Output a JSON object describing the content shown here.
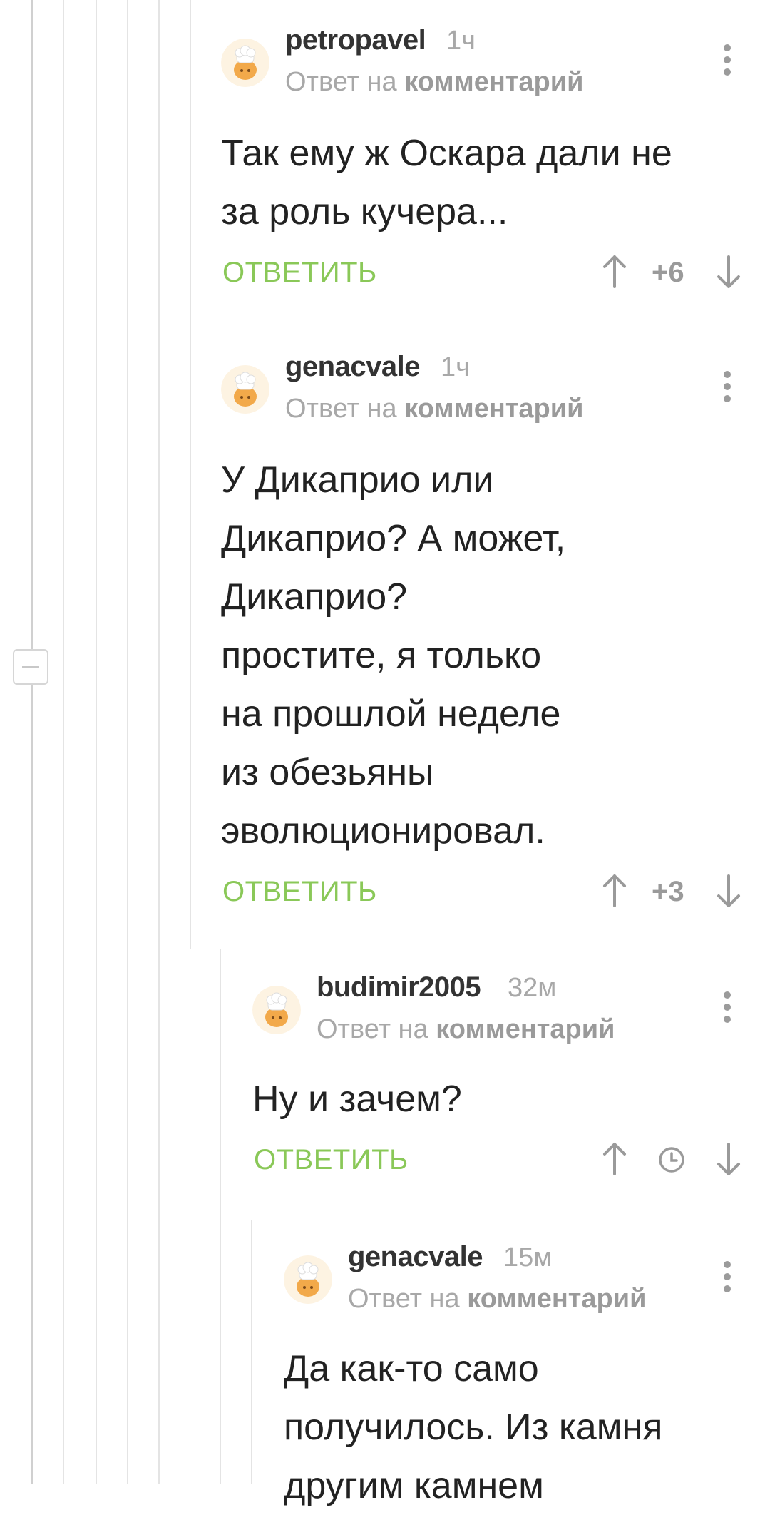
{
  "comments": [
    {
      "username": "petropavel",
      "time": "1ч",
      "reply_prefix": "Ответ на",
      "reply_link": "комментарий",
      "text": "Так ему ж Оскара дали не\nза роль кучера...",
      "reply_label": "ОТВЕТИТЬ",
      "rating": "+6"
    },
    {
      "username": "genacvale",
      "time": "1ч",
      "reply_prefix": "Ответ на",
      "reply_link": "комментарий",
      "text": "У Дикаприо или\nДикаприо? А может,\nДикаприо?\nпростите, я только\nна прошлой неделе\nиз обезьяны\nэволюционировал.",
      "reply_label": "ОТВЕТИТЬ",
      "rating": "+3"
    },
    {
      "username": "budimir2005",
      "time": "32м",
      "reply_prefix": "Ответ на",
      "reply_link": "комментарий",
      "text": "Ну и зачем?",
      "reply_label": "ОТВЕТИТЬ",
      "rating_icon": "clock-icon"
    },
    {
      "username": "genacvale",
      "time": "15м",
      "reply_prefix": "Ответ на",
      "reply_link": "комментарий",
      "text": "Да как-то само\nполучилось. Из камня\nдругим камнем"
    }
  ],
  "colors": {
    "accent_green": "#8ac858",
    "meta_gray": "#a8a8a8",
    "text": "#222222"
  }
}
